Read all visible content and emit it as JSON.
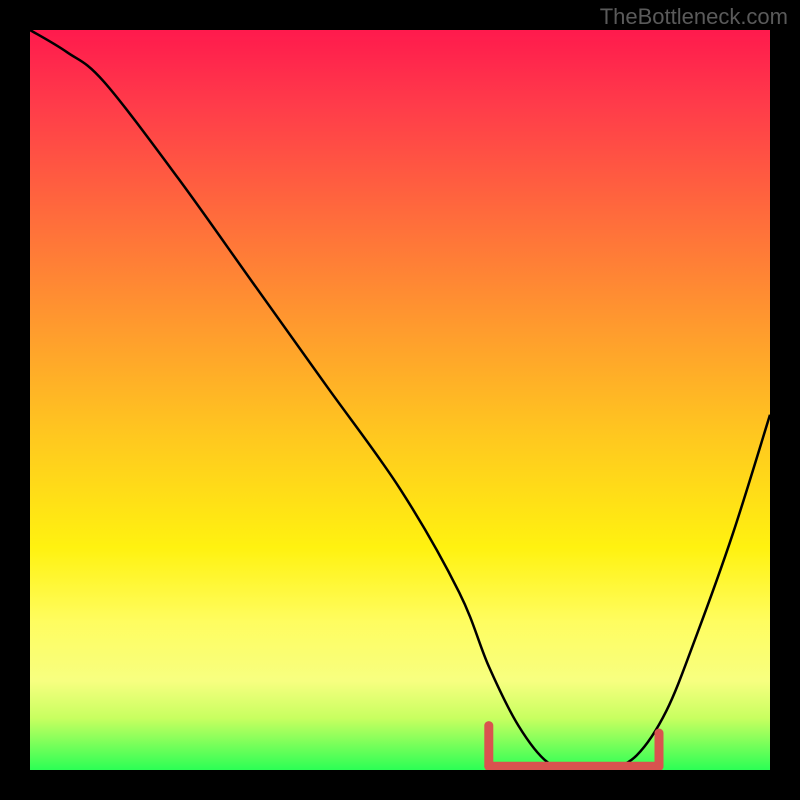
{
  "watermark": "TheBottleneck.com",
  "chart_data": {
    "type": "line",
    "title": "",
    "xlabel": "",
    "ylabel": "",
    "xlim": [
      0,
      100
    ],
    "ylim": [
      0,
      100
    ],
    "series": [
      {
        "name": "curve",
        "color": "#000000",
        "x": [
          0,
          5,
          10,
          20,
          30,
          40,
          50,
          58,
          62,
          66,
          70,
          74,
          78,
          82,
          86,
          90,
          95,
          100
        ],
        "y": [
          100,
          97,
          93,
          80,
          66,
          52,
          38,
          24,
          14,
          6,
          1,
          0,
          0,
          2,
          8,
          18,
          32,
          48
        ]
      }
    ],
    "marker_band": {
      "name": "valley-markers",
      "color": "#d9534f",
      "x_start": 62,
      "x_end": 85,
      "y": 0.5
    },
    "gradient_stops": [
      {
        "pos": 0,
        "color": "#ff1a4d"
      },
      {
        "pos": 25,
        "color": "#ff6b3c"
      },
      {
        "pos": 55,
        "color": "#ffc81f"
      },
      {
        "pos": 80,
        "color": "#fffd60"
      },
      {
        "pos": 100,
        "color": "#2bff55"
      }
    ]
  }
}
